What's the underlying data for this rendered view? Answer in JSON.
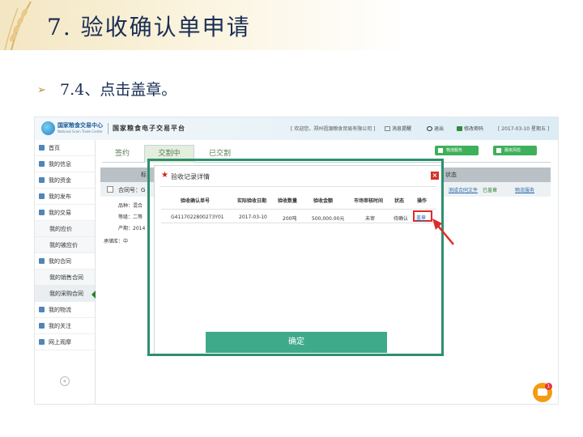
{
  "slide": {
    "title": "7. 验收确认单申请",
    "subtitle_arrow": "➢",
    "subtitle": "7.4、点击盖章。"
  },
  "app": {
    "logo_cn": "国家粮食交易中心",
    "logo_en": "National Grain Trade Center",
    "platform_name": "国家粮食电子交易平台",
    "welcome": "[ 欢迎您，郑州祖源粮食贸易有限公司 ]",
    "message_label": "消息提醒",
    "logout_label": "退出",
    "change_password_label": "修改密码",
    "date": "[ 2017-03-10 星期五 ]"
  },
  "sidebar": {
    "items": [
      {
        "label": "首页",
        "sub": false
      },
      {
        "label": "我的信息",
        "sub": false
      },
      {
        "label": "我的资金",
        "sub": false
      },
      {
        "label": "我的发布",
        "sub": false
      },
      {
        "label": "我的交易",
        "sub": false
      },
      {
        "label": "我的应价",
        "sub": true
      },
      {
        "label": "我的被应价",
        "sub": true
      },
      {
        "label": "我的合同",
        "sub": false
      },
      {
        "label": "我的销售合同",
        "sub": true
      },
      {
        "label": "我的采购合同",
        "sub": true
      },
      {
        "label": "我的物流",
        "sub": false
      },
      {
        "label": "我的关注",
        "sub": false
      },
      {
        "label": "网上观摩",
        "sub": false
      }
    ],
    "collapse_glyph": "«"
  },
  "tabs": {
    "items": [
      "签约",
      "交割中",
      "已交割"
    ],
    "logistics_button": "物流服务",
    "finance_button": "融资风险"
  },
  "table": {
    "header_left": "标",
    "header_status": "状态",
    "contract_label": "合同号：G",
    "info_lines": [
      "品种：混合",
      "等级：二等",
      "产期：2014",
      "承储库：中"
    ],
    "row_link_1": "测成合同文件",
    "row_status": "已盖章",
    "row_link_2": "物流服务"
  },
  "dialog": {
    "title": "验收记录详情",
    "close_glyph": "×",
    "columns": [
      "验收确认单号",
      "实际验收日期",
      "验收数量",
      "验收金额",
      "市场审核时间",
      "状态",
      "操作"
    ],
    "row": {
      "id": "G4117022800273Y01",
      "date": "2017-03-10",
      "quantity": "200吨",
      "amount": "500,000.00元",
      "review": "未审",
      "status": "待确认",
      "action": "盖章"
    },
    "confirm_label": "确定"
  },
  "chat_badge": "1"
}
